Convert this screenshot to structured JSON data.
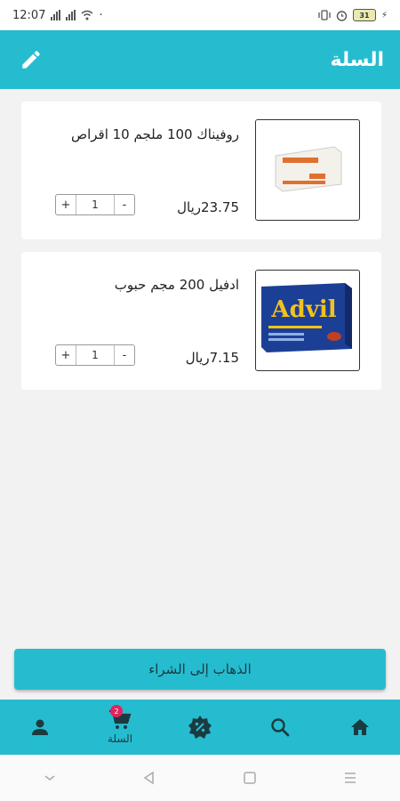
{
  "status_bar": {
    "time": "12:07",
    "battery": "31"
  },
  "app_bar": {
    "title": "السلة"
  },
  "cart_items": [
    {
      "name": "روفيناك 100 ملجم 10 اقراص",
      "price": "23.75ريال",
      "quantity": "1",
      "minus": "-",
      "plus": "+",
      "image_brand": "ROFENAC"
    },
    {
      "name": "ادفيل 200 مجم حبوب",
      "price": "7.15ريال",
      "quantity": "1",
      "minus": "-",
      "plus": "+",
      "image_brand": "Advil"
    }
  ],
  "checkout": {
    "label": "الذهاب إلى الشراء"
  },
  "bottom_nav": {
    "items": [
      {
        "icon": "user-icon",
        "label": ""
      },
      {
        "icon": "cart-icon",
        "label": "السلة",
        "badge": "2"
      },
      {
        "icon": "discount-badge-icon",
        "label": ""
      },
      {
        "icon": "search-icon",
        "label": ""
      },
      {
        "icon": "home-icon",
        "label": ""
      }
    ]
  },
  "colors": {
    "primary": "#26bcd0",
    "badge": "#e0245e",
    "background": "#f2f2f2"
  }
}
